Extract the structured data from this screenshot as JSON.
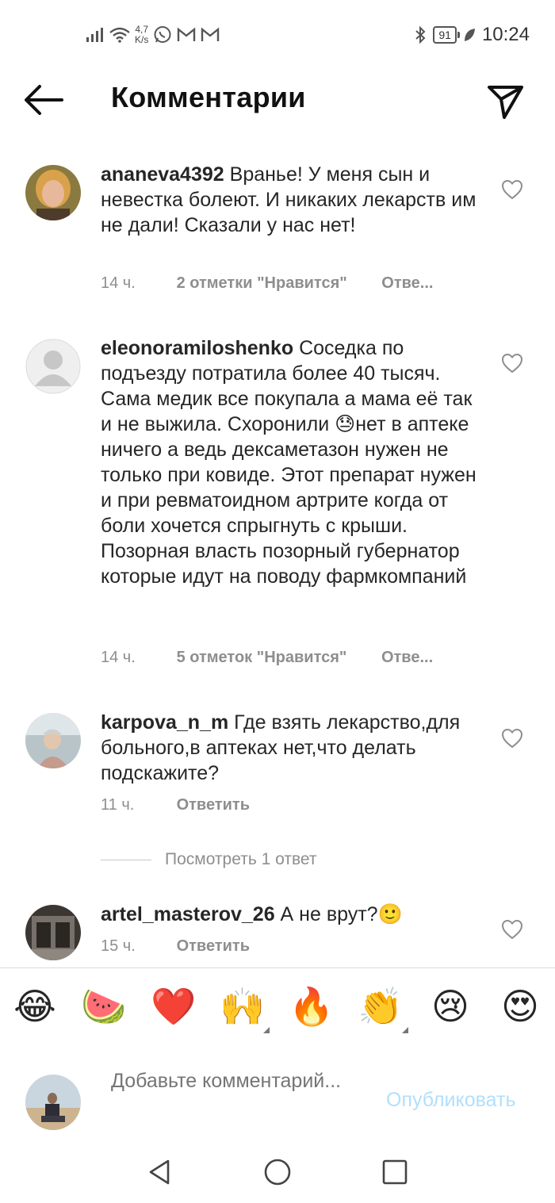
{
  "status_bar": {
    "speed_value": "4,7",
    "speed_unit": "K/s",
    "battery": "91",
    "time": "10:24",
    "left_icons": [
      "signal-icon",
      "wifi-icon",
      "whatsapp-icon",
      "gmail-icon",
      "gmail-icon"
    ],
    "right_icons": [
      "bluetooth-icon",
      "battery-icon",
      "leaf-icon"
    ]
  },
  "header": {
    "title": "Комментарии"
  },
  "comments": [
    {
      "username": "ananeva4392",
      "text": "Вранье! У меня сын и невестка болеют. И никаких лекарств им не дали! Сказали у нас нет!",
      "time": "14 ч.",
      "likes": "2 отметки \"Нравится\"",
      "reply": "Отве..."
    },
    {
      "username": "eleonoramiloshenko",
      "text_before_emoji": "Соседка по подъезду потратила более 40 тысяч. Сама медик все покупала а мама её так и не выжила. Схоронили ",
      "emoji": "😓",
      "text_after_emoji": "нет в аптеке ничего а ведь дексаметазон нужен не только при ковиде. Этот препарат нужен и при ревматоидном артрите когда от боли хочется спрыгнуть с крыши. Позорная власть позорный губернатор которые идут на поводу фармкомпаний",
      "time": "14 ч.",
      "likes": "5 отметок \"Нравится\"",
      "reply": "Отве..."
    },
    {
      "username": "karpova_n_m",
      "text": "Где взять лекарство,для больного,в аптеках нет,что делать подскажите?",
      "time": "11 ч.",
      "reply": "Ответить"
    },
    {
      "username": "artel_masterov_26",
      "text": "А не врут?🙂",
      "time": "15 ч.",
      "reply": "Ответить"
    }
  ],
  "view_replies": "Посмотреть 1 ответ",
  "emoji_bar": [
    "😂",
    "🍉",
    "❤️",
    "🙌",
    "🔥",
    "👏",
    "😢",
    "😍"
  ],
  "input": {
    "placeholder": "Добавьте комментарий...",
    "publish": "Опубликовать"
  },
  "colors": {
    "text": "#262626",
    "meta": "#8e8e8e",
    "publish_disabled": "#b2dffc",
    "divider": "#dbdbdb"
  }
}
